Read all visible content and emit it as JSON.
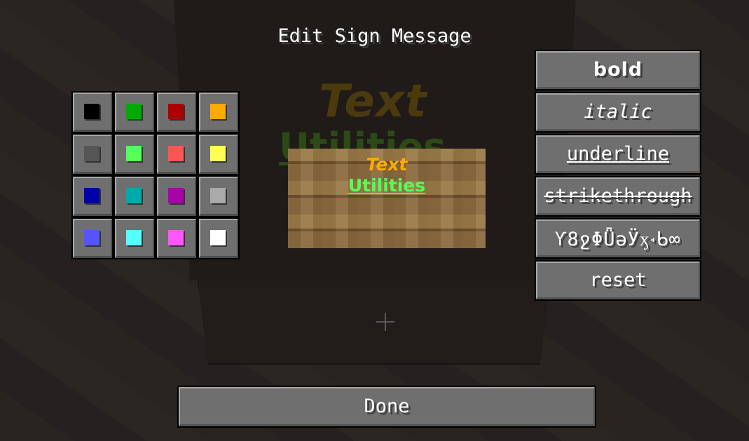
{
  "title": "Edit Sign Message",
  "sign": {
    "line1": "Text",
    "line2": "Utilities",
    "line1_color": "#ffaa00",
    "line2_color": "#55ff55"
  },
  "color_swatches": [
    {
      "name": "black",
      "color": "#000000"
    },
    {
      "name": "dark-green",
      "color": "#00aa00"
    },
    {
      "name": "dark-red",
      "color": "#aa0000"
    },
    {
      "name": "gold",
      "color": "#ffaa00"
    },
    {
      "name": "dark-gray",
      "color": "#555555"
    },
    {
      "name": "green",
      "color": "#55ff55"
    },
    {
      "name": "red",
      "color": "#ff5555"
    },
    {
      "name": "yellow",
      "color": "#ffff55"
    },
    {
      "name": "dark-blue",
      "color": "#0000aa"
    },
    {
      "name": "dark-aqua",
      "color": "#00aaaa"
    },
    {
      "name": "dark-purple",
      "color": "#aa00aa"
    },
    {
      "name": "gray",
      "color": "#aaaaaa"
    },
    {
      "name": "blue",
      "color": "#5555ff"
    },
    {
      "name": "aqua",
      "color": "#55ffff"
    },
    {
      "name": "light-purple",
      "color": "#ff55ff"
    },
    {
      "name": "white",
      "color": "#ffffff"
    }
  ],
  "format_buttons": {
    "bold": "bold",
    "italic": "italic",
    "underline": "underline",
    "strikethrough": "strikethrough",
    "obfuscated": "Ƴ8ջΦǕǝӰӽ꭪ᑲ∞",
    "reset": "reset"
  },
  "done_label": "Done"
}
